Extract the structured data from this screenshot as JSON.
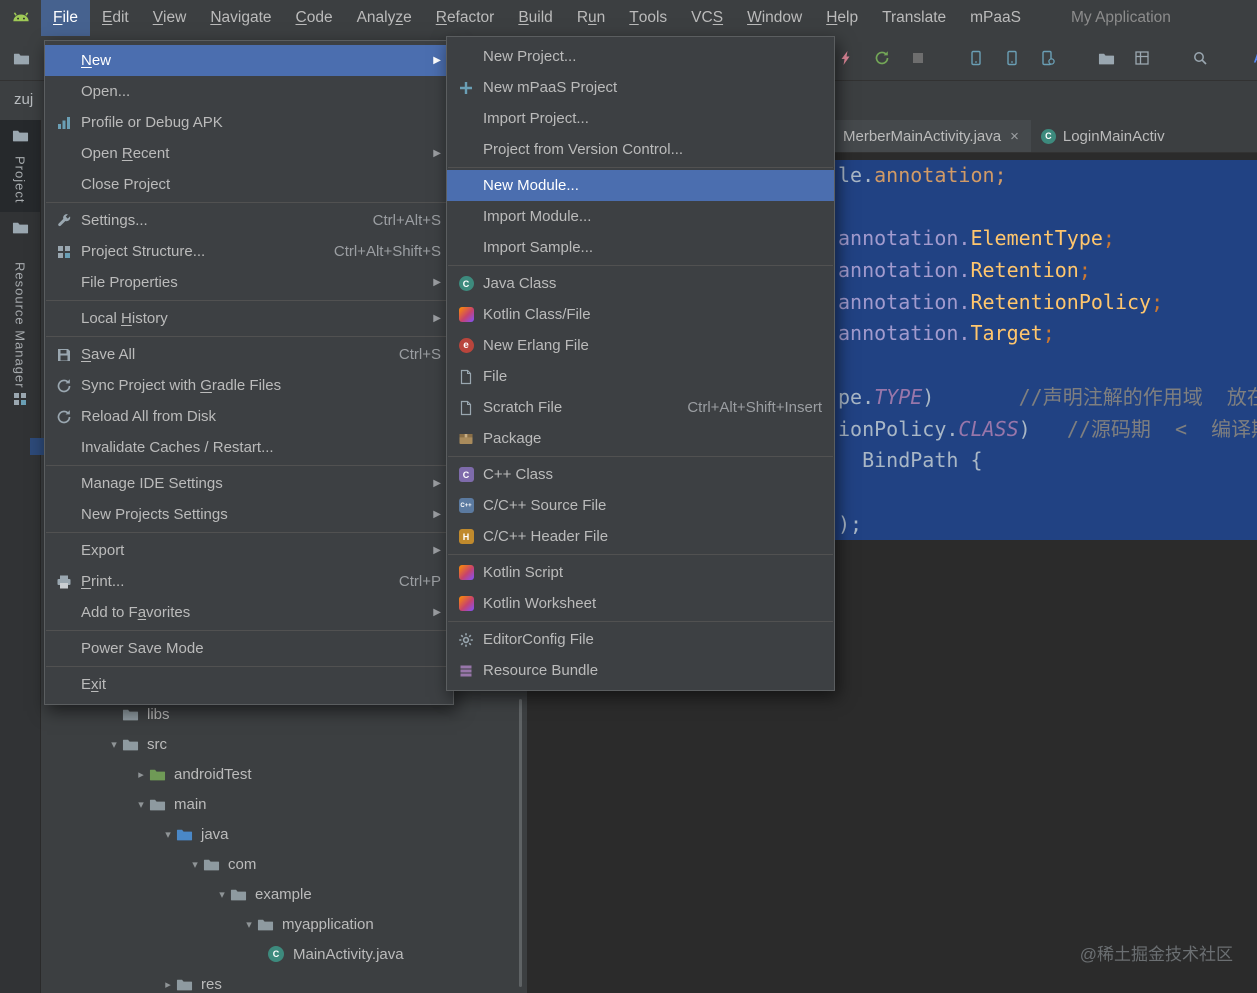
{
  "window": {
    "title": "My Application",
    "breadcrumb": "zuj"
  },
  "colors": {
    "menu_selection": "#4b6eaf",
    "menubar_active": "#46628f",
    "editor_selection": "#214283",
    "editor_bg": "#2b2b2b",
    "panel_bg": "#3c3f41",
    "stripe_bg": "#313335",
    "code_default": "#a9b7c6",
    "code_class": "#ffc66d",
    "code_constant": "#9876aa",
    "code_comment": "#7f7f7f",
    "code_package": "#a29bce",
    "code_punct": "#cc7832"
  },
  "menu_bar": {
    "items": [
      {
        "label": "File",
        "u": 0,
        "active": true
      },
      {
        "label": "Edit",
        "u": 0
      },
      {
        "label": "View",
        "u": 0
      },
      {
        "label": "Navigate",
        "u": 0
      },
      {
        "label": "Code",
        "u": 0
      },
      {
        "label": "Analyze",
        "u": 5
      },
      {
        "label": "Refactor",
        "u": 0
      },
      {
        "label": "Build",
        "u": 0
      },
      {
        "label": "Run",
        "u": 1
      },
      {
        "label": "Tools",
        "u": 0
      },
      {
        "label": "VCS",
        "u": 2
      },
      {
        "label": "Window",
        "u": 0
      },
      {
        "label": "Help",
        "u": 0
      },
      {
        "label": "Translate"
      },
      {
        "label": "mPaaS"
      }
    ]
  },
  "toolbar": {
    "left_icon": {
      "name": "open-icon",
      "type": "folder",
      "color": "#9aa7b0"
    },
    "right_icons": [
      {
        "name": "apply-changes-icon",
        "type": "lightning",
        "color": "#e0889a"
      },
      {
        "name": "apply-code-changes-icon",
        "type": "refresh",
        "color": "#73a657"
      },
      {
        "name": "stop-icon",
        "type": "stopsq",
        "color": "#6e6e6e"
      },
      {
        "name": "profiler-icon",
        "type": "phone",
        "color": "#6a9fb5",
        "gap": true
      },
      {
        "name": "device-icon",
        "type": "phone",
        "color": "#6a9fb5"
      },
      {
        "name": "avd-manager-icon",
        "type": "phonegear",
        "color": "#6a9fb5"
      },
      {
        "name": "device-file-explorer-icon",
        "type": "folder",
        "color": "#9aa7b0",
        "gap": true
      },
      {
        "name": "layout-inspector-icon",
        "type": "layout",
        "color": "#9aa7b0"
      },
      {
        "name": "search-everywhere-icon",
        "type": "search",
        "color": "#9aa7b0",
        "gap": true
      },
      {
        "name": "translate-icon",
        "type": "letterA",
        "color": "#5a8af5",
        "gap": true
      }
    ]
  },
  "tool_windows": {
    "project": "Project",
    "resource_manager": "Resource Manager"
  },
  "file_menu": {
    "groups": [
      [
        {
          "label": "New",
          "u": 0,
          "arrow": true,
          "selected": true
        },
        {
          "label": "Open..."
        },
        {
          "label": "Profile or Debug APK",
          "icon": {
            "name": "profile-apk-icon",
            "type": "chart"
          }
        },
        {
          "label": "Open Recent",
          "u": 5,
          "arrow": true
        },
        {
          "label": "Close Project"
        }
      ],
      [
        {
          "label": "Settings...",
          "icon": {
            "name": "settings-icon",
            "type": "wrench"
          },
          "shortcut": "Ctrl+Alt+S"
        },
        {
          "label": "Project Structure...",
          "icon": {
            "name": "project-structure-icon",
            "type": "grid"
          },
          "shortcut": "Ctrl+Alt+Shift+S"
        },
        {
          "label": "File Properties",
          "arrow": true
        }
      ],
      [
        {
          "label": "Local History",
          "u": 6,
          "arrow": true
        }
      ],
      [
        {
          "label": "Save All",
          "u": 0,
          "icon": {
            "name": "save-all-icon",
            "type": "floppy"
          },
          "shortcut": "Ctrl+S"
        },
        {
          "label": "Sync Project with Gradle Files",
          "u": 18,
          "icon": {
            "name": "gradle-sync-icon",
            "type": "refresh"
          }
        },
        {
          "label": "Reload All from Disk",
          "icon": {
            "name": "reload-icon",
            "type": "refresh"
          }
        },
        {
          "label": "Invalidate Caches / Restart..."
        }
      ],
      [
        {
          "label": "Manage IDE Settings",
          "arrow": true
        },
        {
          "label": "New Projects Settings",
          "arrow": true
        }
      ],
      [
        {
          "label": "Export",
          "arrow": true
        },
        {
          "label": "Print...",
          "u": 0,
          "icon": {
            "name": "print-icon",
            "type": "printer"
          },
          "shortcut": "Ctrl+P"
        },
        {
          "label": "Add to Favorites",
          "u": 8,
          "arrow": true
        }
      ],
      [
        {
          "label": "Power Save Mode"
        }
      ],
      [
        {
          "label": "Exit",
          "u": 1
        }
      ]
    ]
  },
  "new_submenu": {
    "groups": [
      [
        {
          "label": "New Project..."
        },
        {
          "label": "New mPaaS Project",
          "icon": {
            "name": "mpaas-project-icon",
            "type": "plus"
          }
        },
        {
          "label": "Import Project..."
        },
        {
          "label": "Project from Version Control..."
        }
      ],
      [
        {
          "label": "New Module...",
          "selected": true
        },
        {
          "label": "Import Module..."
        },
        {
          "label": "Import Sample..."
        }
      ],
      [
        {
          "label": "Java Class",
          "icon": {
            "name": "java-class-icon",
            "badge": "C",
            "round": true,
            "bg": "#3d8a7d"
          }
        },
        {
          "label": "Kotlin Class/File",
          "icon": {
            "name": "kotlin-icon",
            "badge": "",
            "bg": "linear-gradient(135deg,#ff8f00,#c6426e 55%,#7f52ff)"
          }
        },
        {
          "label": "New Erlang File",
          "icon": {
            "name": "erlang-icon",
            "badge": "e",
            "round": true,
            "bg": "#b9453c",
            "fs": 10
          }
        },
        {
          "label": "File",
          "icon": {
            "name": "file-icon",
            "type": "file"
          }
        },
        {
          "label": "Scratch File",
          "icon": {
            "name": "scratch-file-icon",
            "type": "file"
          },
          "shortcut": "Ctrl+Alt+Shift+Insert"
        },
        {
          "label": "Package",
          "icon": {
            "name": "package-icon",
            "type": "package"
          }
        }
      ],
      [
        {
          "label": "C++ Class",
          "icon": {
            "name": "cpp-class-icon",
            "badge": "C",
            "bg": "#7e6bab"
          }
        },
        {
          "label": "C/C++ Source File",
          "icon": {
            "name": "cpp-source-icon",
            "badge": "C++",
            "bg": "#5b7aa0",
            "fs": 6
          }
        },
        {
          "label": "C/C++ Header File",
          "icon": {
            "name": "cpp-header-icon",
            "badge": "H",
            "bg": "#c08a2d"
          }
        }
      ],
      [
        {
          "label": "Kotlin Script",
          "icon": {
            "name": "kotlin-script-icon",
            "badge": "",
            "bg": "linear-gradient(135deg,#ff8f00,#c6426e 55%,#7f52ff)"
          }
        },
        {
          "label": "Kotlin Worksheet",
          "icon": {
            "name": "kotlin-worksheet-icon",
            "badge": "",
            "bg": "linear-gradient(135deg,#ff8f00,#c6426e 55%,#7f52ff)"
          }
        }
      ],
      [
        {
          "label": "EditorConfig File",
          "icon": {
            "name": "editorconfig-icon",
            "type": "gear"
          }
        },
        {
          "label": "Resource Bundle",
          "icon": {
            "name": "resource-bundle-icon",
            "type": "bundle"
          }
        }
      ]
    ]
  },
  "editor": {
    "tabs": [
      {
        "label": "MerberMainActivity.java",
        "close": true,
        "active": true
      },
      {
        "label": "LoginMainActiv",
        "icon": {
          "name": "class-icon",
          "badge": "C",
          "round": true,
          "bg": "#3d8a7d"
        }
      }
    ],
    "watermark": "@稀土掘金技术社区",
    "code_lines": [
      {
        "sel": true,
        "seg": [
          {
            "t": "le.",
            "c": "#a9b7c6"
          },
          {
            "t": "annotation;",
            "c": "#d19a66"
          }
        ]
      },
      {
        "sel": true,
        "seg": []
      },
      {
        "sel": true,
        "seg": [
          {
            "t": "annotation.",
            "c": "#a29bce"
          },
          {
            "t": "ElementType",
            "c": "#ffc66d"
          },
          {
            "t": ";",
            "c": "#cc7832"
          }
        ]
      },
      {
        "sel": true,
        "seg": [
          {
            "t": "annotation.",
            "c": "#a29bce"
          },
          {
            "t": "Retention",
            "c": "#ffc66d"
          },
          {
            "t": ";",
            "c": "#cc7832"
          }
        ]
      },
      {
        "sel": true,
        "seg": [
          {
            "t": "annotation.",
            "c": "#a29bce"
          },
          {
            "t": "RetentionPolicy",
            "c": "#ffc66d"
          },
          {
            "t": ";",
            "c": "#cc7832"
          }
        ]
      },
      {
        "sel": true,
        "seg": [
          {
            "t": "annotation.",
            "c": "#a29bce"
          },
          {
            "t": "Target",
            "c": "#ffc66d"
          },
          {
            "t": ";",
            "c": "#cc7832"
          }
        ]
      },
      {
        "sel": true,
        "seg": []
      },
      {
        "sel": true,
        "seg": [
          {
            "t": "pe.",
            "c": "#a9b7c6"
          },
          {
            "t": "TYPE",
            "c": "#9876aa",
            "i": true
          },
          {
            "t": ")",
            "c": "#a9b7c6"
          },
          {
            "t": "       "
          },
          {
            "t": "//声明注解的作用域",
            "c": "#7f7f7f"
          },
          {
            "t": "  放在什么上",
            "c": "#7f7f7f"
          }
        ]
      },
      {
        "sel": true,
        "seg": [
          {
            "t": "ionPolicy.",
            "c": "#a9b7c6"
          },
          {
            "t": "CLASS",
            "c": "#9876aa",
            "i": true
          },
          {
            "t": ")",
            "c": "#a9b7c6"
          },
          {
            "t": "   "
          },
          {
            "t": "//源码期",
            "c": "#7f7f7f"
          },
          {
            "t": "  <  编译期",
            "c": "#7f7f7f"
          }
        ]
      },
      {
        "sel": true,
        "seg": [
          {
            "t": "  BindPath {",
            "c": "#a9b7c6"
          }
        ]
      },
      {
        "sel": true,
        "seg": []
      },
      {
        "sel": true,
        "seg": [
          {
            "t": ");",
            "c": "#a9b7c6"
          }
        ]
      }
    ]
  },
  "project_tree": {
    "items": [
      {
        "label": "libs",
        "depth": 2,
        "chevron": "none",
        "icon": "folder",
        "color": "#8e9aa0"
      },
      {
        "label": "src",
        "depth": 2,
        "chevron": "down",
        "icon": "folder",
        "color": "#8e9aa0"
      },
      {
        "label": "androidTest",
        "depth": 3,
        "chevron": "right",
        "icon": "folder",
        "color": "#6f9a56"
      },
      {
        "label": "main",
        "depth": 3,
        "chevron": "down",
        "icon": "folder",
        "color": "#8e9aa0"
      },
      {
        "label": "java",
        "depth": 4,
        "chevron": "down",
        "icon": "folder",
        "color": "#4a88c7"
      },
      {
        "label": "com",
        "depth": 5,
        "chevron": "down",
        "icon": "folder",
        "color": "#8e9aa0"
      },
      {
        "label": "example",
        "depth": 6,
        "chevron": "down",
        "icon": "folder",
        "color": "#8e9aa0"
      },
      {
        "label": "myapplication",
        "depth": 7,
        "chevron": "down",
        "icon": "folder",
        "color": "#8e9aa0"
      },
      {
        "label": "MainActivity.java",
        "depth": 8,
        "chevron": "leaf",
        "icon": "class"
      },
      {
        "label": "res",
        "depth": 4,
        "chevron": "right",
        "icon": "folder",
        "color": "#8e9aa0"
      }
    ]
  }
}
